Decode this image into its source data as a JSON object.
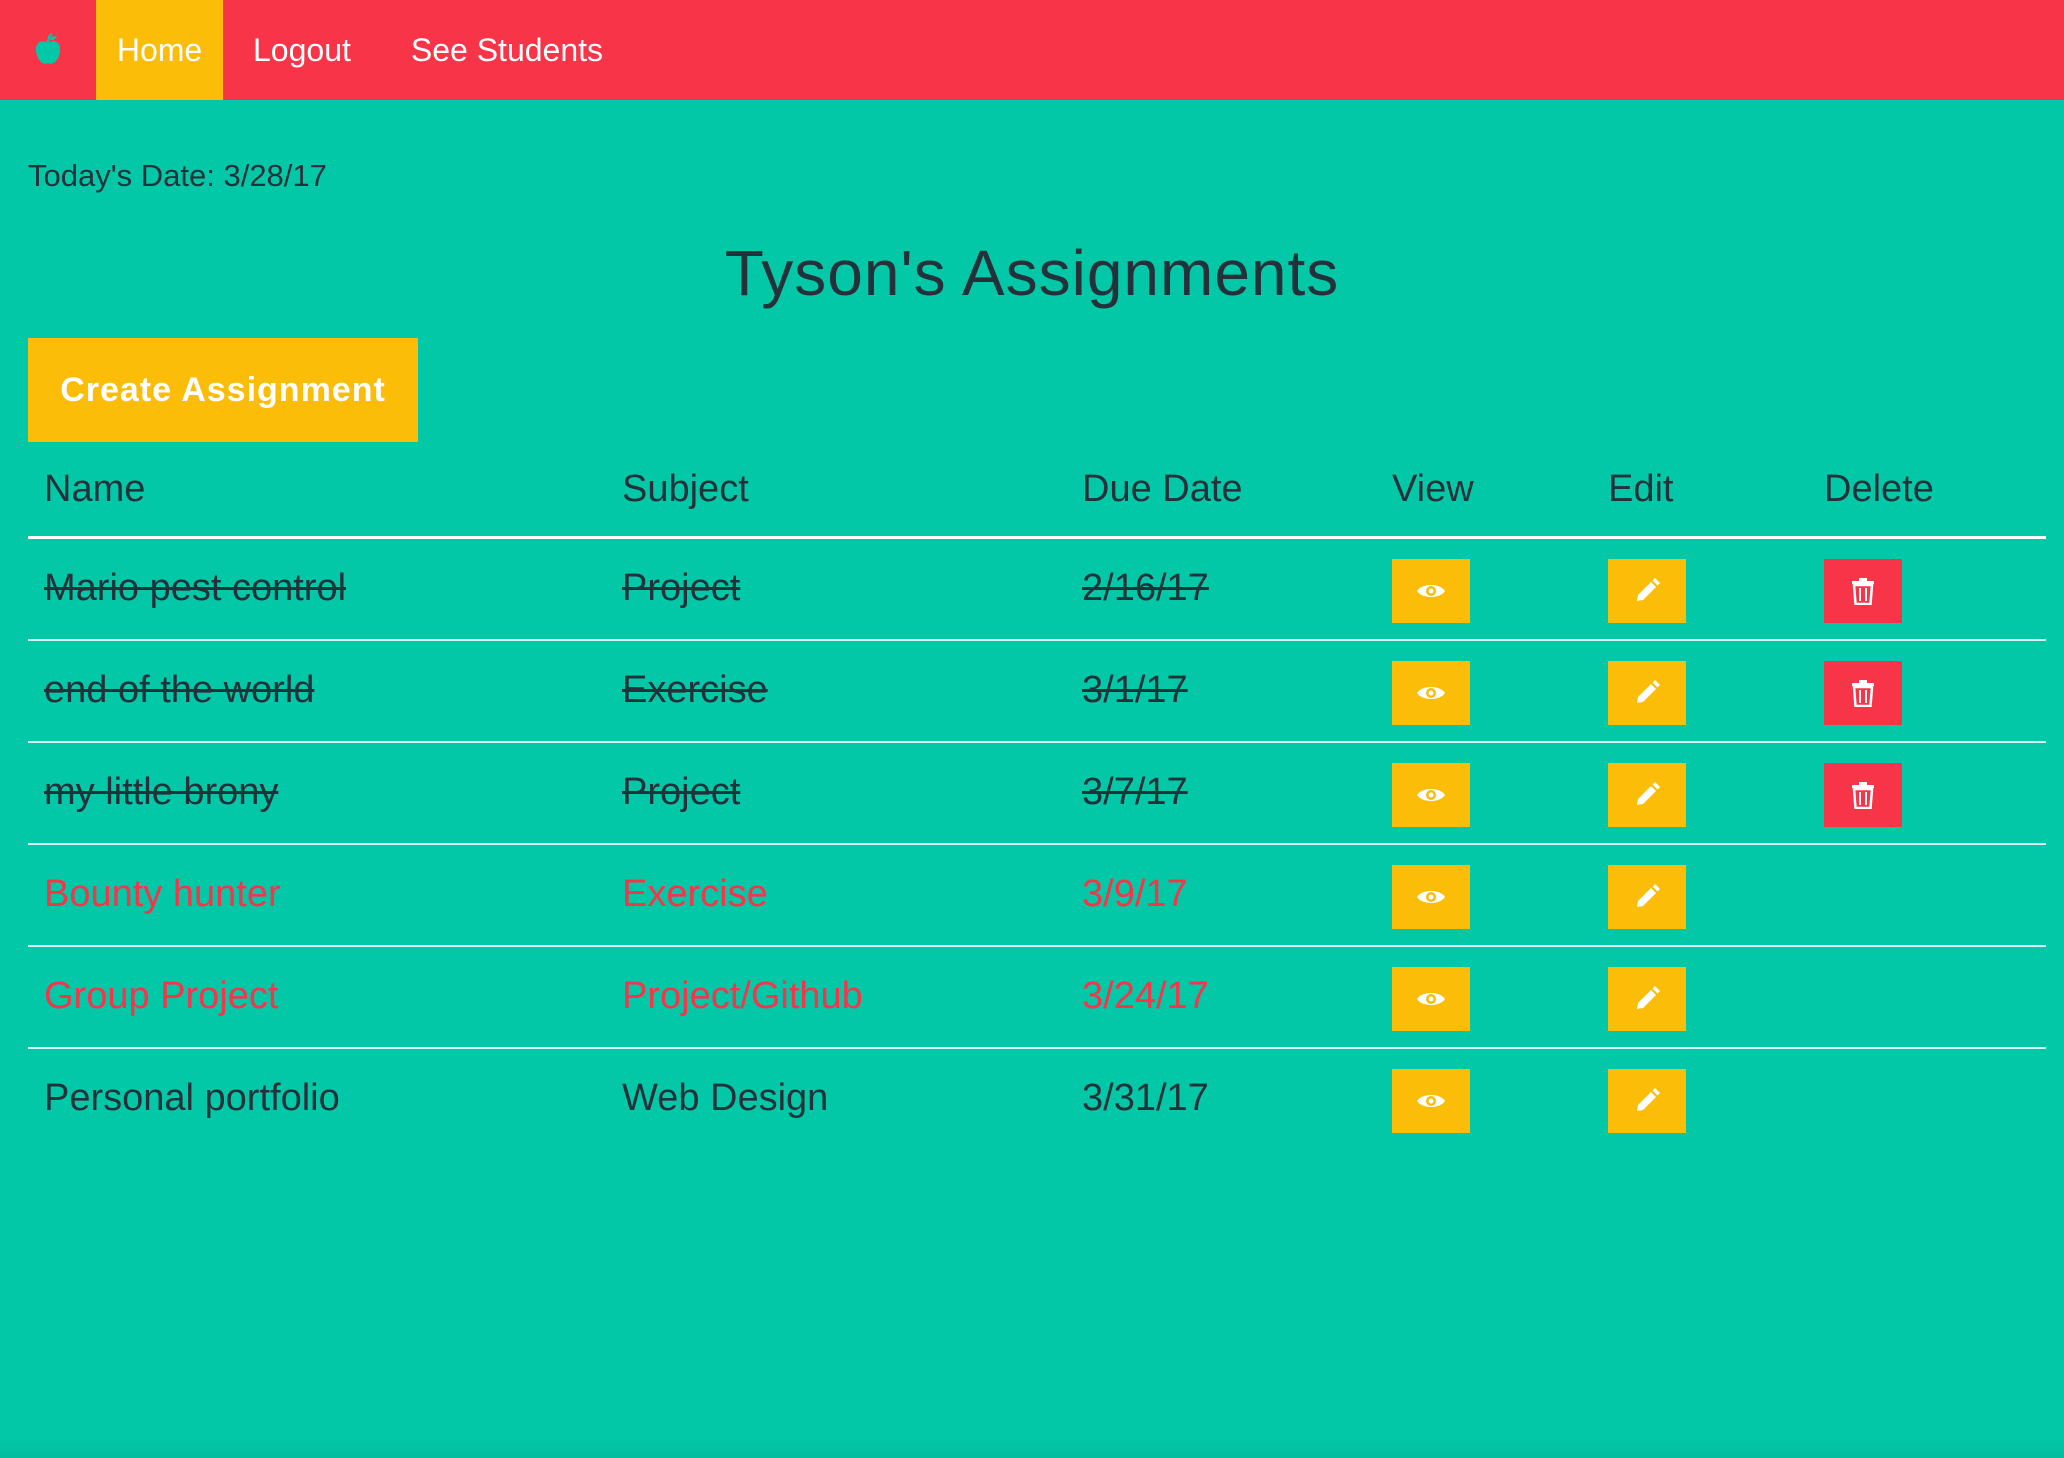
{
  "navbar": {
    "brand_icon": "apple-icon",
    "items": [
      {
        "label": "Home",
        "active": true
      },
      {
        "label": "Logout",
        "active": false
      },
      {
        "label": "See Students",
        "active": false
      }
    ]
  },
  "today_label": "Today's Date: 3/28/17",
  "page_title": "Tyson's Assignments",
  "create_button_label": "Create Assignment",
  "table": {
    "headers": {
      "name": "Name",
      "subject": "Subject",
      "due": "Due Date",
      "view": "View",
      "edit": "Edit",
      "delete": "Delete"
    },
    "rows": [
      {
        "name": "Mario pest control",
        "subject": "Project",
        "due": "2/16/17",
        "status": "done",
        "deletable": true
      },
      {
        "name": "end of the world",
        "subject": "Exercise",
        "due": "3/1/17",
        "status": "done",
        "deletable": true
      },
      {
        "name": "my little brony",
        "subject": "Project",
        "due": "3/7/17",
        "status": "done",
        "deletable": true
      },
      {
        "name": "Bounty hunter",
        "subject": "Exercise",
        "due": "3/9/17",
        "status": "overdue",
        "deletable": false
      },
      {
        "name": "Group Project",
        "subject": "Project/Github",
        "due": "3/24/17",
        "status": "overdue",
        "deletable": false
      },
      {
        "name": "Personal portfolio",
        "subject": "Web Design",
        "due": "3/31/17",
        "status": "normal",
        "deletable": false
      }
    ]
  },
  "colors": {
    "background": "#03c8a8",
    "navbar": "#f73448",
    "accent_yellow": "#fbbd08",
    "danger_red": "#f73448",
    "text_dark": "#22313a"
  },
  "icons": {
    "view": "eye-icon",
    "edit": "pencil-icon",
    "delete": "trash-icon"
  }
}
